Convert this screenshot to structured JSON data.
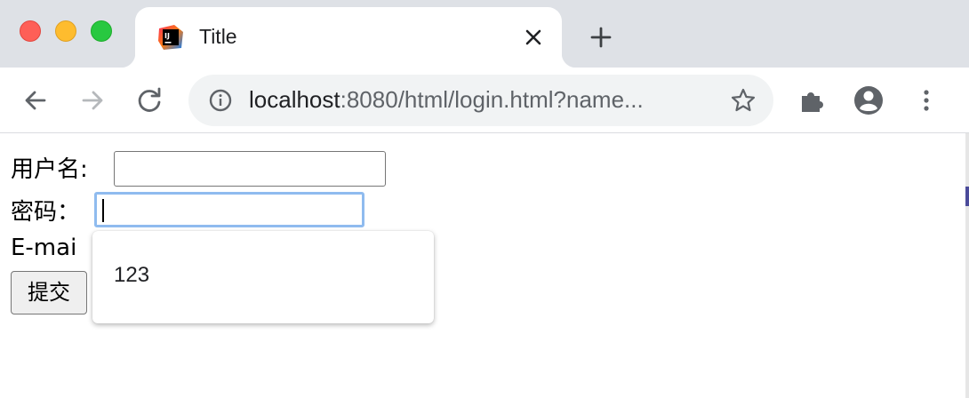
{
  "browser": {
    "tab": {
      "title": "Title",
      "favicon": "intellij-icon",
      "close_icon": "close-icon"
    },
    "new_tab_icon": "plus-icon",
    "toolbar": {
      "back_icon": "arrow-left-icon",
      "forward_icon": "arrow-right-icon",
      "reload_icon": "reload-icon",
      "info_icon": "info-icon",
      "url_host": "localhost",
      "url_rest": ":8080/html/login.html?name...",
      "bookmark_icon": "star-icon",
      "extensions_icon": "puzzle-icon",
      "profile_icon": "account-icon",
      "menu_icon": "kebab-menu-icon"
    }
  },
  "form": {
    "username_label": "用户名:",
    "username_value": "",
    "password_label": "密码：",
    "password_value": "",
    "email_label": "E-mai",
    "submit_label": "提交"
  },
  "autocomplete": {
    "items": [
      "123"
    ]
  },
  "colors": {
    "tabstrip": "#dee1e6",
    "omnibox": "#f1f3f4",
    "focus_ring": "#8fbbef",
    "traffic_red": "#fe5f57",
    "traffic_yellow": "#febc2e",
    "traffic_green": "#28c840"
  }
}
